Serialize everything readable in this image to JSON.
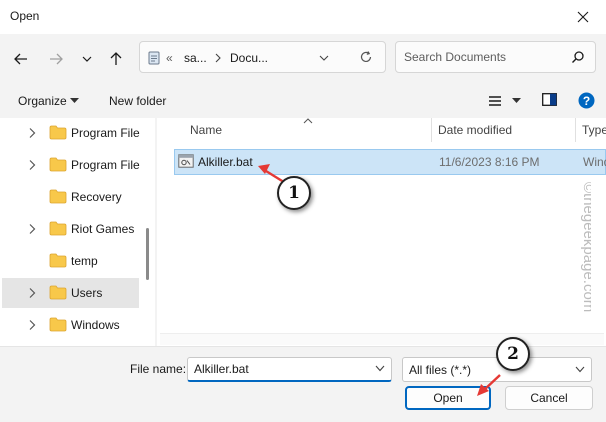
{
  "window": {
    "title": "Open"
  },
  "address": {
    "part1": "sa...",
    "part2": "Docu...",
    "overflow": "«"
  },
  "search": {
    "placeholder": "Search Documents"
  },
  "toolbar": {
    "organize": "Organize",
    "new_folder": "New folder"
  },
  "tree": {
    "items": [
      {
        "label": "Program File",
        "expandable": true
      },
      {
        "label": "Program File",
        "expandable": true
      },
      {
        "label": "Recovery",
        "expandable": false
      },
      {
        "label": "Riot Games",
        "expandable": true
      },
      {
        "label": "temp",
        "expandable": false
      },
      {
        "label": "Users",
        "expandable": true,
        "selected": true
      },
      {
        "label": "Windows",
        "expandable": true
      }
    ]
  },
  "file_list": {
    "columns": {
      "name": "Name",
      "date": "Date modified",
      "type": "Type"
    },
    "rows": [
      {
        "name": "Alkiller.bat",
        "date": "11/6/2023 8:16 PM",
        "type": "Wind"
      }
    ]
  },
  "footer": {
    "filename_label": "File name:",
    "filename_value": "Alkiller.bat",
    "filetype_value": "All files (*.*)",
    "open_label": "Open",
    "cancel_label": "Cancel"
  },
  "annotations": {
    "step1": "1",
    "step2": "2",
    "watermark": "©thegeekpage.com"
  },
  "colors": {
    "accent": "#0067c0",
    "selection": "#cce4f7",
    "folder": "#f8c84a",
    "arrow": "#e53935",
    "help": "#0067c0"
  }
}
